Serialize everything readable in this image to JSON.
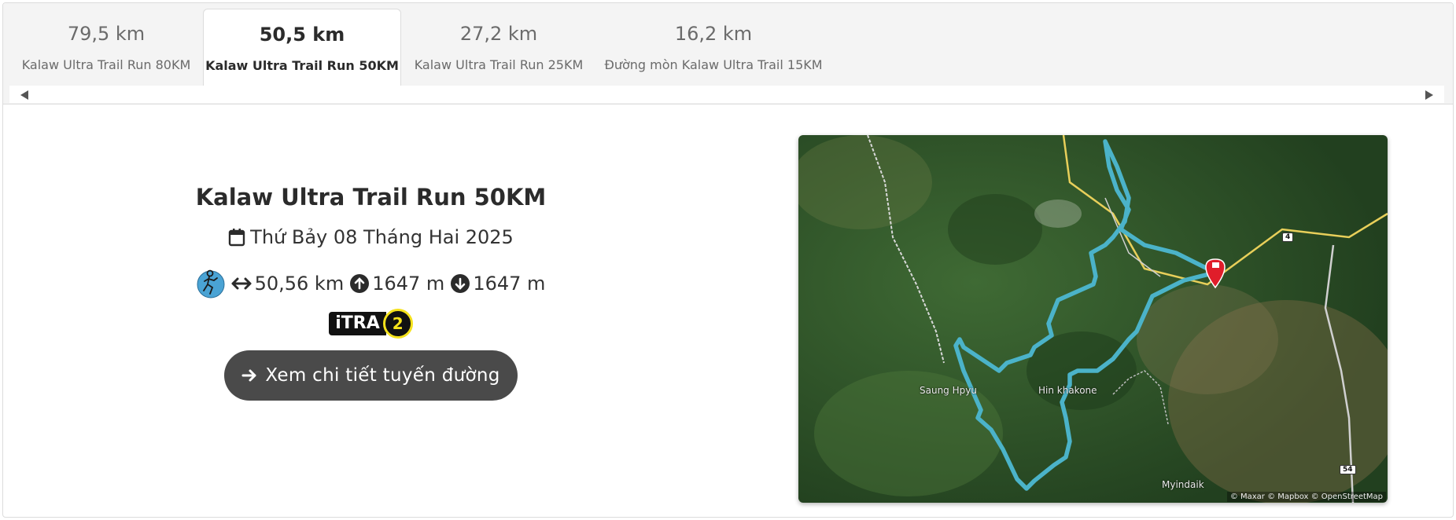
{
  "tabs": [
    {
      "distance": "79,5 km",
      "name": "Kalaw Ultra Trail Run 80KM"
    },
    {
      "distance": "50,5 km",
      "name": "Kalaw Ultra Trail Run 50KM"
    },
    {
      "distance": "27,2 km",
      "name": "Kalaw Ultra Trail Run 25KM"
    },
    {
      "distance": "16,2 km",
      "name": "Đường mòn Kalaw Ultra Trail 15KM"
    }
  ],
  "active_tab": 1,
  "race": {
    "title": "Kalaw Ultra Trail Run 50KM",
    "date": "Thứ Bảy 08 Tháng Hai 2025",
    "distance": "50,56 km",
    "elevation_gain": "1647 m",
    "elevation_loss": "1647 m",
    "itra_label": "iTRA",
    "itra_points": "2",
    "cta_label": "Xem chi tiết tuyến đường"
  },
  "map": {
    "places": [
      "Saung Hpyu",
      "Hin khakone",
      "Myindaik"
    ],
    "road_shields": [
      "4",
      "54"
    ],
    "attribution": "© Maxar © Mapbox © OpenStreetMap",
    "route_color": "#4bb3c9"
  },
  "icons": [
    "calendar-icon",
    "runner-icon",
    "distance-arrows-icon",
    "arrow-up-circle-icon",
    "arrow-down-circle-icon",
    "arrow-right-icon",
    "chevron-left-icon",
    "chevron-right-icon",
    "finish-flag-icon"
  ]
}
